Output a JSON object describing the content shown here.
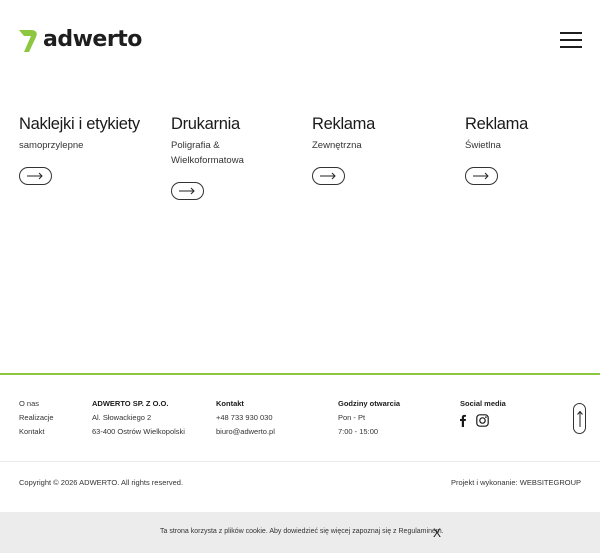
{
  "header": {
    "brand": "adwerto",
    "menu_icon": "hamburger-menu-icon"
  },
  "colors": {
    "accent": "#8dc63f",
    "text": "#1e1e1e",
    "cookie_bg": "#ececec"
  },
  "categories": [
    {
      "title": "Naklejki i etykiety",
      "subtitle": "samoprzylepne"
    },
    {
      "title": "Drukarnia",
      "subtitle": "Poligrafia & Wielkoformatowa"
    },
    {
      "title": "Reklama",
      "subtitle": "Zewnętrzna"
    },
    {
      "title": "Reklama",
      "subtitle": "Świetlna"
    }
  ],
  "footer": {
    "links": [
      "O nas",
      "Realizacje",
      "Kontakt"
    ],
    "company": {
      "name": "ADWERTO SP. Z O.O.",
      "street": "Al. Słowackiego 2",
      "city": "63-400 Ostrów Wielkopolski"
    },
    "contact": {
      "heading": "Kontakt",
      "phone": "+48 733 930 030",
      "email": "biuro@adwerto.pl"
    },
    "hours": {
      "heading": "Godziny otwarcia",
      "days": "Pon - Pt",
      "time": "7:00 - 15:00"
    },
    "social": {
      "heading": "Social media",
      "icons": [
        "facebook-icon",
        "instagram-icon"
      ]
    },
    "copyright": "Copyright © 2026 ADWERTO. All rights reserved.",
    "credits": "Projekt i wykonanie: WEBSITEGROUP"
  },
  "cookie": {
    "text": "Ta strona korzysta z plików cookie. Aby dowiedzieć się więcej zapoznaj się z Regulaminem.",
    "close": "X"
  }
}
